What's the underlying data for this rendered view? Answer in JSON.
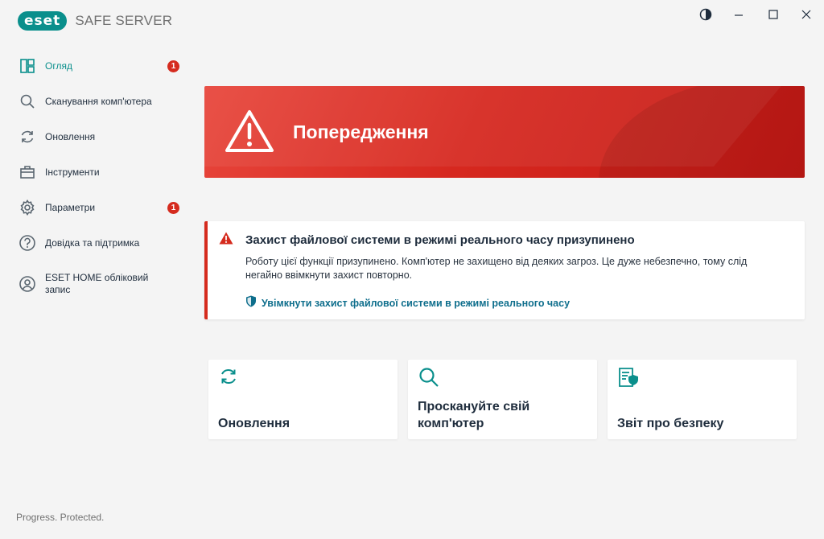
{
  "app": {
    "logo": "eset",
    "product": "SAFE SERVER",
    "tagline": "Progress. Protected."
  },
  "window": {
    "theme_icon": "contrast-icon",
    "minimize_icon": "minimize-icon",
    "maximize_icon": "maximize-icon",
    "close_icon": "close-icon"
  },
  "sidebar": {
    "items": [
      {
        "label": "Огляд",
        "icon": "overview-icon",
        "badge": "1",
        "active": true
      },
      {
        "label": "Сканування комп'ютера",
        "icon": "search-icon"
      },
      {
        "label": "Оновлення",
        "icon": "refresh-icon"
      },
      {
        "label": "Інструменти",
        "icon": "toolbox-icon"
      },
      {
        "label": "Параметри",
        "icon": "gear-icon",
        "badge": "1"
      },
      {
        "label": "Довідка та підтримка",
        "icon": "help-icon"
      },
      {
        "label": "ESET HOME обліковий запис",
        "icon": "account-icon"
      }
    ]
  },
  "banner": {
    "title": "Попередження",
    "icon": "warning-icon",
    "color": "#d6281f"
  },
  "alert": {
    "title": "Захист файлової системи в режимі реального часу призупинено",
    "description": "Роботу цієї функції призупинено. Комп'ютер не захищено від деяких загроз. Це дуже небезпечно, тому слід негайно ввімкнути захист повторно.",
    "link": "Увімкнути захист файлової системи в режимі реального часу",
    "icon": "warning-icon",
    "link_icon": "shield-icon",
    "color": "#d52b1e"
  },
  "tiles": [
    {
      "label": "Оновлення",
      "icon": "refresh-icon"
    },
    {
      "label": "Проскануйте свій комп'ютер",
      "icon": "search-icon"
    },
    {
      "label": "Звіт про безпеку",
      "icon": "security-report-icon"
    }
  ],
  "colors": {
    "accent": "#0a8f8c",
    "danger": "#d52b1e",
    "link": "#0e6e8c"
  }
}
